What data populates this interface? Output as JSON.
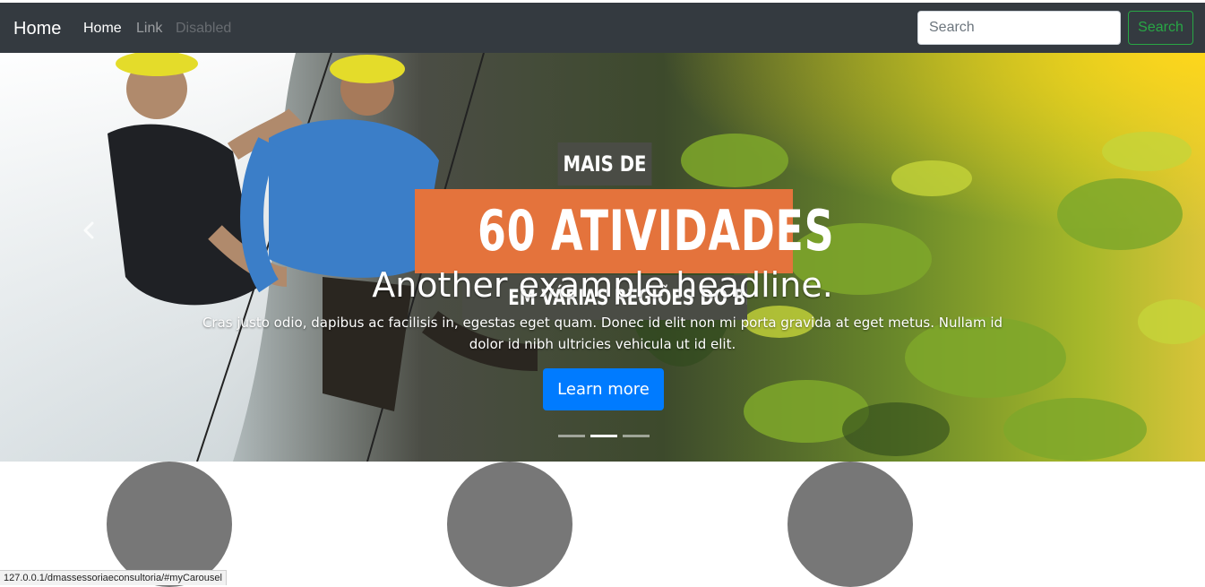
{
  "navbar": {
    "brand": "Home",
    "links": [
      {
        "label": "Home"
      },
      {
        "label": "Link"
      },
      {
        "label": "Disabled"
      }
    ],
    "search_placeholder": "Search",
    "search_button": "Search"
  },
  "carousel": {
    "banner": {
      "top": "MAIS DE",
      "main": "60 ATIVIDADES",
      "bottom": "EM VÁRIAS REGIÕES DO BRASIL"
    },
    "caption_title": "Another example headline.",
    "caption_text": "Cras justo odio, dapibus ac facilisis in, egestas eget quam. Donec id elit non mi porta gravida at eget metus. Nullam id dolor id nibh ultricies vehicula ut id elit.",
    "button_label": "Learn more",
    "slide_count": 3,
    "active_slide": 2
  },
  "status_bar": {
    "url": "127.0.0.1/dmassessoriaeconsultoria/#myCarousel"
  },
  "colors": {
    "navbar_bg": "#343a40",
    "success": "#28a745",
    "primary": "#007bff",
    "banner_orange": "#e4733c",
    "banner_dark": "#4a4c45",
    "circle_placeholder": "#777777"
  }
}
